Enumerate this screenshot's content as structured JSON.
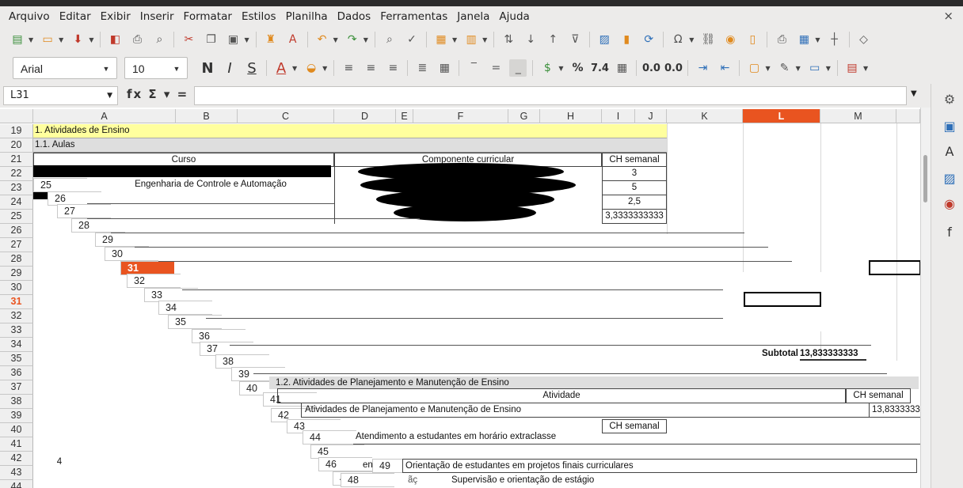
{
  "menu": [
    "Arquivo",
    "Editar",
    "Exibir",
    "Inserir",
    "Formatar",
    "Estilos",
    "Planilha",
    "Dados",
    "Ferramentas",
    "Janela",
    "Ajuda"
  ],
  "close_glyph": "×",
  "font_name": "Arial",
  "font_size": "10",
  "fmt": {
    "bold": "N",
    "italic": "I",
    "underline": "S",
    "percent": "%",
    "number": "7.4",
    "dec_add": "0.0",
    "dec_del": "0.0"
  },
  "name_box": "L31",
  "formula_icons": "fx Σ ▾ =",
  "columns": [
    "A",
    "B",
    "C",
    "D",
    "E",
    "F",
    "G",
    "H",
    "I",
    "J",
    "K",
    "L",
    "M"
  ],
  "selected_col": "L",
  "rows": [
    "19",
    "20",
    "21",
    "22",
    "23",
    "24",
    "25",
    "26",
    "27",
    "28",
    "29",
    "30",
    "31",
    "32",
    "33",
    "34",
    "35",
    "36",
    "37",
    "38",
    "39",
    "40",
    "41",
    "42",
    "43",
    "44"
  ],
  "selected_row": "31",
  "cells": {
    "r19": "1. Atividades de Ensino",
    "r20": "1.1. Aulas",
    "curso": "Curso",
    "componente": "Componente curricular",
    "ch_semanal": "CH semanal",
    "v22": "3",
    "v23": "5",
    "v24": "2,5",
    "v25": "3,3333333333",
    "curso23": "Engenharia de Controle e Automação",
    "subtotal_label": "Subtotal",
    "subtotal_val": "13,833333333",
    "planejamento": "1.2. Atividades de Planejamento e Manutenção de Ensino",
    "atividade": "Atividade",
    "ch_semanal2": "CH semanal",
    "atividades_plan": "Atividades de Planejamento e Manutenção de Ensino",
    "val39": "13,8333333",
    "ch_semanal3": "CH semanal",
    "atendimento": "Atendimento a estudantes em horário extraclasse",
    "orientacao": "Orientação de estudantes em projetos finais curriculares",
    "supervisao": "Supervisão e orientação de estágio",
    "pref_en": "en",
    "pref_ac": "ãç",
    "val4": "4"
  },
  "glitch_rows": [
    "25",
    "26",
    "27",
    "28",
    "29",
    "30",
    "31",
    "32",
    "33",
    "34",
    "35",
    "36",
    "37",
    "38",
    "39",
    "40",
    "41",
    "42",
    "43",
    "44",
    "45",
    "46",
    "47",
    "48",
    "49"
  ]
}
